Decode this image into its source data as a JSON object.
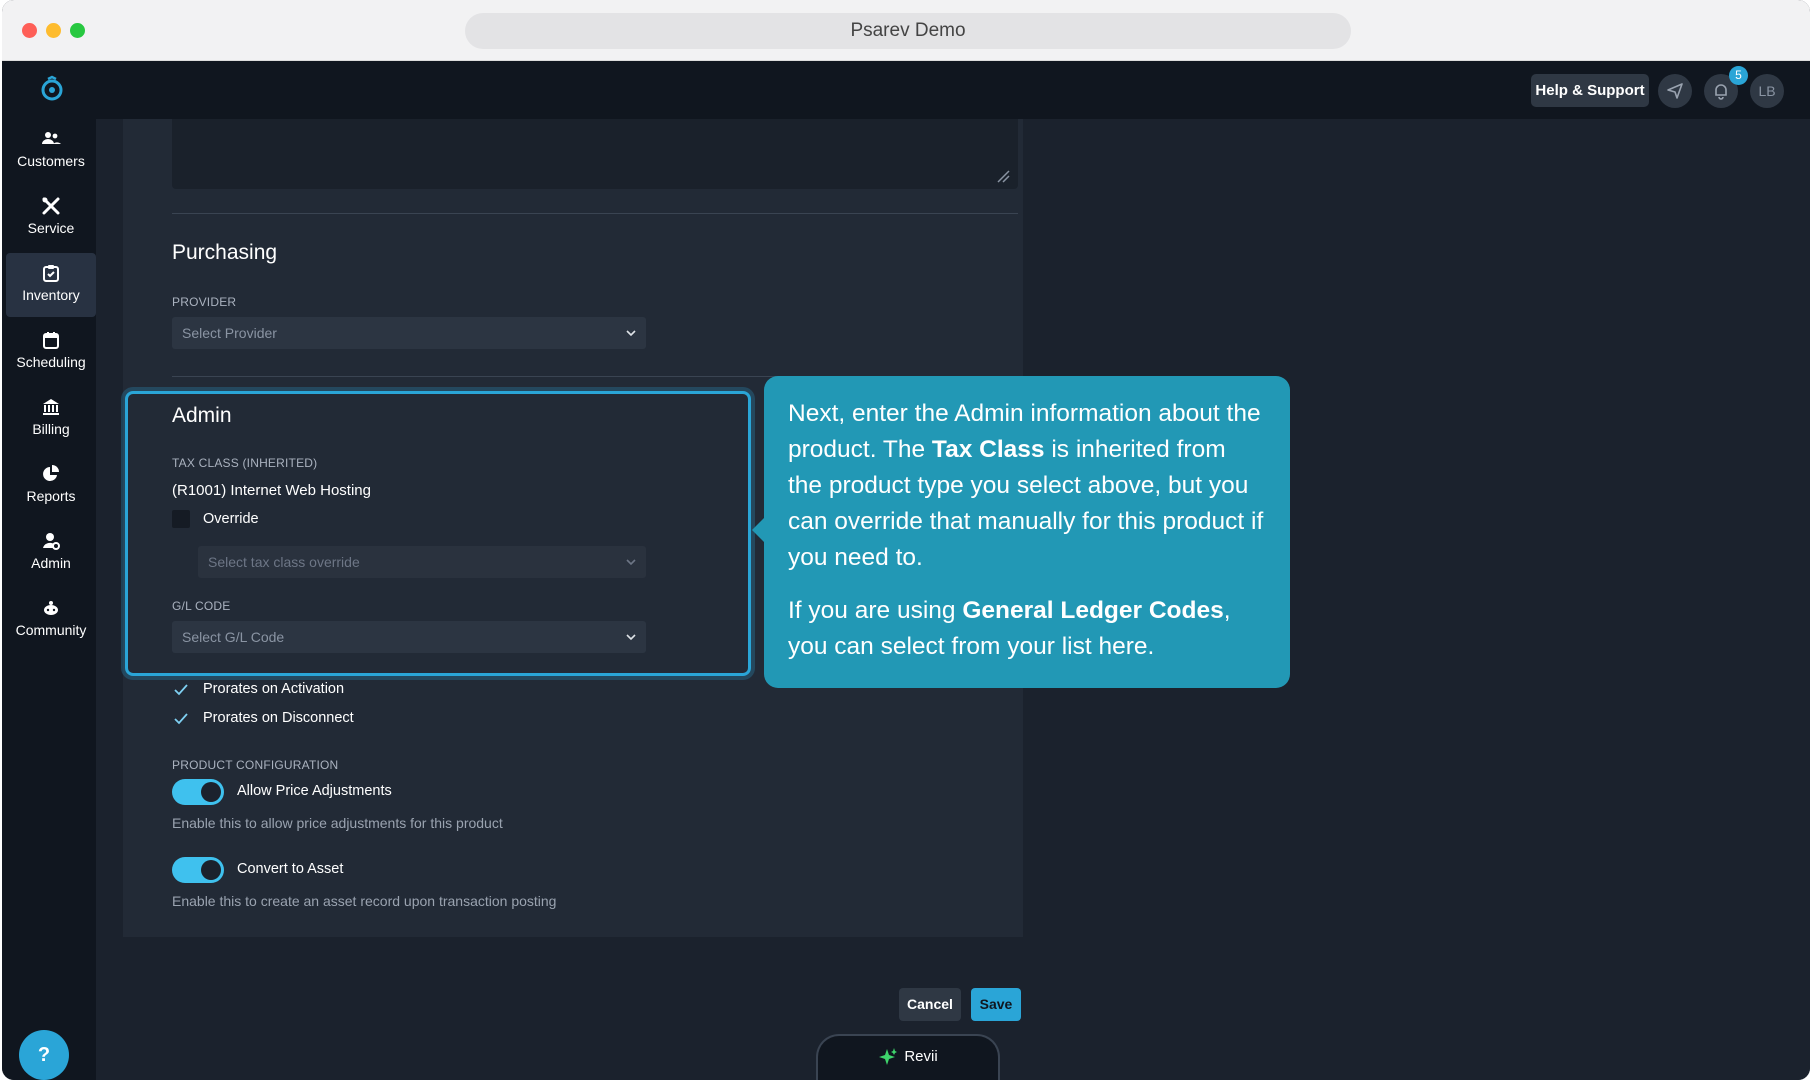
{
  "window": {
    "url_title": "Psarev Demo"
  },
  "header": {
    "help_label": "Help & Support",
    "notification_count": "5",
    "avatar_initials": "LB",
    "accent_color": "#2aa5d7"
  },
  "sidebar": {
    "items": [
      {
        "label": "Customers",
        "icon": "users-icon"
      },
      {
        "label": "Service",
        "icon": "tools-icon"
      },
      {
        "label": "Inventory",
        "icon": "clipboard-check-icon",
        "active": true
      },
      {
        "label": "Scheduling",
        "icon": "calendar-icon"
      },
      {
        "label": "Billing",
        "icon": "bank-icon"
      },
      {
        "label": "Reports",
        "icon": "pie-chart-icon"
      },
      {
        "label": "Admin",
        "icon": "user-cog-icon"
      },
      {
        "label": "Community",
        "icon": "community-icon"
      }
    ],
    "help_fab": "?"
  },
  "form": {
    "purchasing": {
      "title": "Purchasing",
      "provider_label": "PROVIDER",
      "provider_placeholder": "Select Provider"
    },
    "admin": {
      "title": "Admin",
      "tax_class_label": "TAX CLASS (INHERITED)",
      "tax_class_value": "(R1001) Internet Web Hosting",
      "override_label": "Override",
      "override_placeholder": "Select tax class override",
      "gl_label": "G/L CODE",
      "gl_placeholder": "Select G/L Code"
    },
    "prorates_activation": "Prorates on Activation",
    "prorates_disconnect": "Prorates on Disconnect",
    "product_config": {
      "label": "PRODUCT CONFIGURATION",
      "allow_price_label": "Allow Price Adjustments",
      "allow_price_desc": "Enable this to allow price adjustments for this product",
      "convert_asset_label": "Convert to Asset",
      "convert_asset_desc": "Enable this to create an asset record upon transaction posting"
    }
  },
  "tooltip": {
    "p1_a": "Next, enter the Admin information about the product. The ",
    "p1_b": "Tax Class",
    "p1_c": " is inherited from the product type you select above, but you can override that manually for this product if you need to.",
    "p2_a": "If you are using ",
    "p2_b": "General Ledger Codes",
    "p2_c": ", you can select from your list here."
  },
  "actions": {
    "cancel": "Cancel",
    "save": "Save"
  },
  "revii": {
    "label": "Revii"
  }
}
